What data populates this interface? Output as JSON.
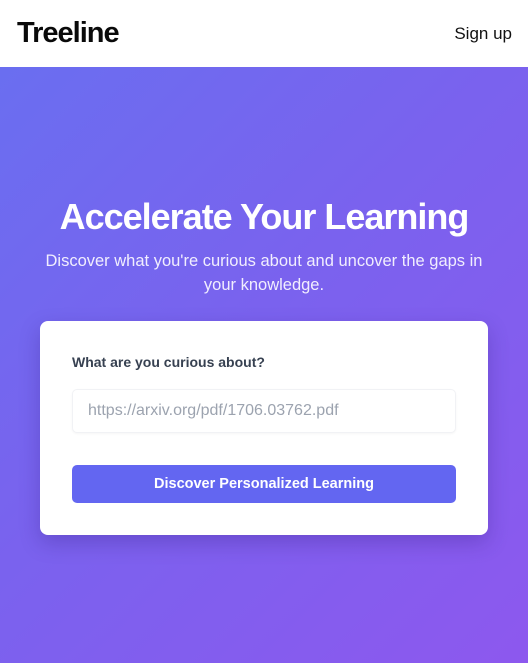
{
  "header": {
    "logo_text": "Treeline",
    "signup_label": "Sign up"
  },
  "hero": {
    "title": "Accelerate Your Learning",
    "subtitle": "Discover what you're curious about and uncover the gaps in your knowledge."
  },
  "form": {
    "label": "What are you curious about?",
    "input_value": "",
    "input_placeholder": "https://arxiv.org/pdf/1706.03762.pdf",
    "submit_label": "Discover Personalized Learning"
  },
  "colors": {
    "gradient_start": "#6a6ef0",
    "gradient_end": "#8d58ee",
    "button": "#6366f1"
  }
}
